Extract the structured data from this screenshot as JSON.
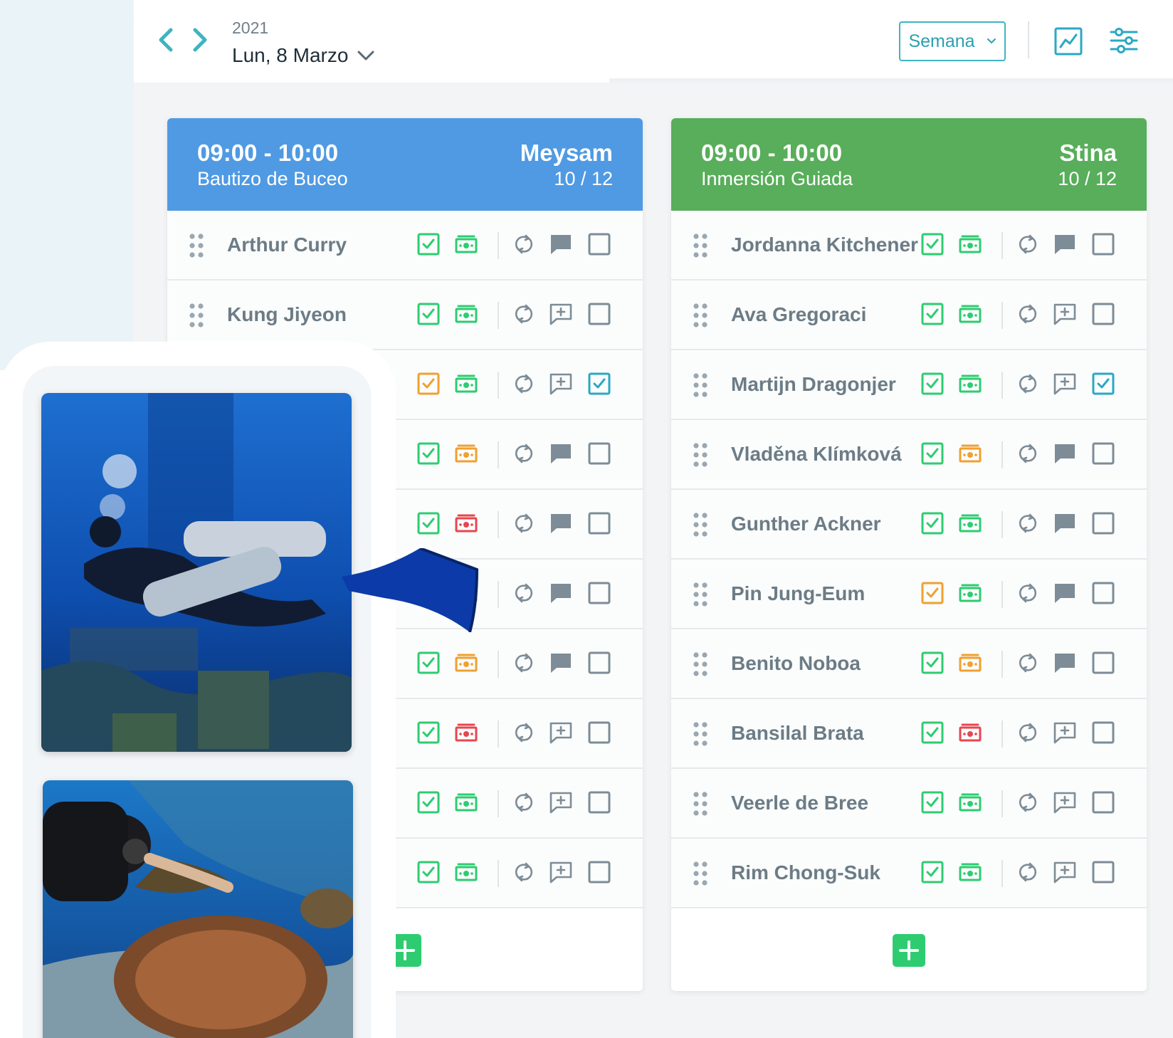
{
  "header": {
    "year": "2021",
    "date": "Lun, 8 Marzo",
    "view_select": "Semana"
  },
  "colors": {
    "accent": "#3fb4c0",
    "session_blue": "#4f9ae3",
    "session_green": "#58ae5a",
    "check_green": "#2ecc71",
    "warning_orange": "#f0a030",
    "alert_red": "#e8464f",
    "attended_teal": "#2aa8c4"
  },
  "sessions": [
    {
      "time": "09:00 - 10:00",
      "activity": "Bautizo de Buceo",
      "guide": "Meysam",
      "count": "10 / 12",
      "participants": [
        {
          "name": "Arthur Curry",
          "check": "green",
          "payment": "green",
          "comment": "filled",
          "attended": false
        },
        {
          "name": "Kung Jiyeon",
          "check": "green",
          "payment": "green",
          "comment": "add",
          "attended": false
        },
        {
          "name": "",
          "check": "orange",
          "payment": "green",
          "comment": "add",
          "attended": true
        },
        {
          "name": "",
          "check": "green",
          "payment": "orange",
          "comment": "filled",
          "attended": false
        },
        {
          "name": "",
          "check": "green",
          "payment": "red",
          "comment": "filled",
          "attended": false
        },
        {
          "name": "",
          "check": "green",
          "payment": "green",
          "comment": "filled",
          "attended": false
        },
        {
          "name": "",
          "check": "green",
          "payment": "orange",
          "comment": "filled",
          "attended": false
        },
        {
          "name": "",
          "check": "green",
          "payment": "red",
          "comment": "add",
          "attended": false
        },
        {
          "name": "",
          "check": "green",
          "payment": "green",
          "comment": "add",
          "attended": false
        },
        {
          "name": "",
          "check": "green",
          "payment": "green",
          "comment": "add",
          "attended": false
        }
      ]
    },
    {
      "time": "09:00 - 10:00",
      "activity": "Inmersión Guiada",
      "guide": "Stina",
      "count": "10 / 12",
      "participants": [
        {
          "name": "Jordanna Kitchener",
          "check": "green",
          "payment": "green",
          "comment": "filled",
          "attended": false
        },
        {
          "name": "Ava Gregoraci",
          "check": "green",
          "payment": "green",
          "comment": "add",
          "attended": false
        },
        {
          "name": "Martijn Dragonjer",
          "check": "green",
          "payment": "green",
          "comment": "add",
          "attended": true
        },
        {
          "name": "Vladěna Klímková",
          "check": "green",
          "payment": "orange",
          "comment": "filled",
          "attended": false
        },
        {
          "name": "Gunther Ackner",
          "check": "green",
          "payment": "green",
          "comment": "filled",
          "attended": false
        },
        {
          "name": "Pin Jung-Eum",
          "check": "orange",
          "payment": "green",
          "comment": "filled",
          "attended": false
        },
        {
          "name": "Benito Noboa",
          "check": "green",
          "payment": "orange",
          "comment": "filled",
          "attended": false
        },
        {
          "name": "Bansilal Brata",
          "check": "green",
          "payment": "red",
          "comment": "add",
          "attended": false
        },
        {
          "name": "Veerle de Bree",
          "check": "green",
          "payment": "green",
          "comment": "add",
          "attended": false
        },
        {
          "name": "Rim Chong-Suk",
          "check": "green",
          "payment": "green",
          "comment": "add",
          "attended": false
        }
      ]
    }
  ],
  "photos": [
    {
      "name": "diver-wreck-photo"
    },
    {
      "name": "diver-turtle-photo"
    }
  ]
}
